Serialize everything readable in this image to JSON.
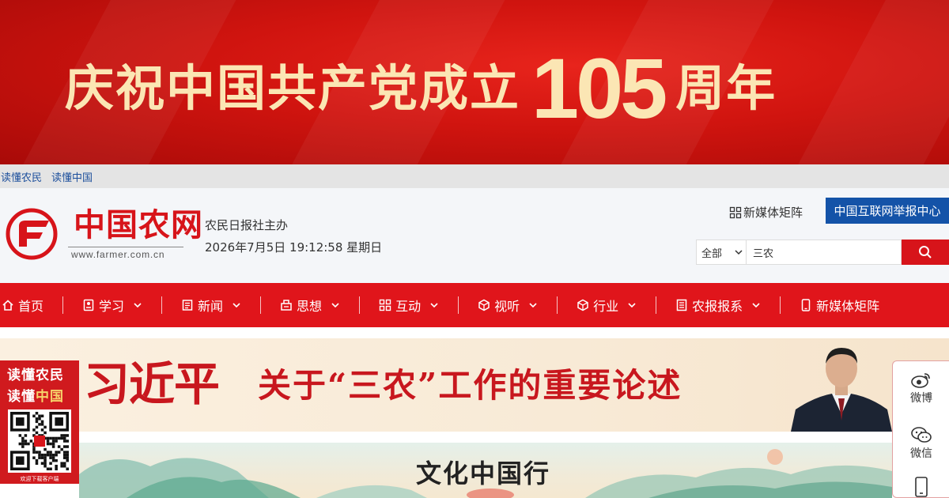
{
  "banner": {
    "text_cn": "庆祝中国共产党成立",
    "number": "105",
    "suffix": "周年"
  },
  "toplinks": [
    {
      "label": "读懂农民"
    },
    {
      "label": "读懂中国"
    }
  ],
  "header": {
    "logo_cn": "中国农网",
    "logo_url": "www.farmer.com.cn",
    "sponsor": "农民日报社主办",
    "datetime": "2026年7月5日 19:12:58 星期日",
    "media_matrix": "新媒体矩阵",
    "report_center": "中国互联网举报中心"
  },
  "search": {
    "scope": "全部",
    "query": "三农"
  },
  "nav": [
    {
      "label": "首页",
      "icon": "home-icon",
      "dropdown": false
    },
    {
      "label": "学习",
      "icon": "study-icon",
      "dropdown": true
    },
    {
      "label": "新闻",
      "icon": "news-icon",
      "dropdown": true
    },
    {
      "label": "思想",
      "icon": "thought-icon",
      "dropdown": true
    },
    {
      "label": "互动",
      "icon": "interact-icon",
      "dropdown": true
    },
    {
      "label": "视听",
      "icon": "media-icon",
      "dropdown": true
    },
    {
      "label": "行业",
      "icon": "industry-icon",
      "dropdown": true
    },
    {
      "label": "农报报系",
      "icon": "paper-icon",
      "dropdown": true
    },
    {
      "label": "新媒体矩阵",
      "icon": "mobile-icon",
      "dropdown": false
    }
  ],
  "feature": {
    "name": "习近平",
    "title": "关于“三农”工作的重要论述"
  },
  "scenic": {
    "title": "文化中国行"
  },
  "qr_widget": {
    "line1": "读懂农民",
    "line2_a": "读懂",
    "line2_b": "中国",
    "caption": "欢迎下载客户端"
  },
  "share": [
    {
      "label": "微博",
      "icon": "weibo-icon"
    },
    {
      "label": "微信",
      "icon": "wechat-icon"
    },
    {
      "label": "",
      "icon": "mobile-icon"
    }
  ],
  "colors": {
    "brand_red": "#e0151b",
    "banner_gold": "#fbe6b4",
    "report_blue": "#1453a8",
    "link_blue": "#1d4f9c"
  }
}
